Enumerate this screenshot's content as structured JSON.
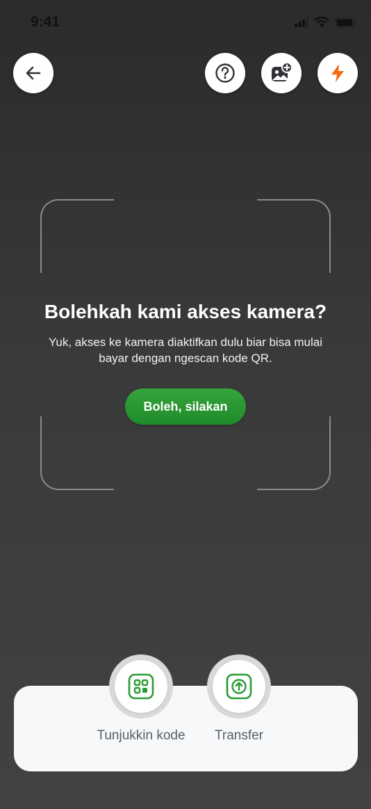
{
  "status_bar": {
    "time": "9:41"
  },
  "header": {
    "icons": [
      "back-arrow-icon",
      "help-icon",
      "gallery-add-icon",
      "flash-icon"
    ],
    "accent_color": "#f46b14"
  },
  "camera_prompt": {
    "title": "Bolehkah kami akses kamera?",
    "description": "Yuk, akses ke kamera diaktifkan dulu biar bisa mulai bayar dengan ngescan kode QR.",
    "allow_button_label": "Boleh, silakan",
    "button_color": "#2a9a33"
  },
  "bottom_actions": [
    {
      "label": "Tunjukkin kode",
      "icon": "qr-code-icon"
    },
    {
      "label": "Transfer",
      "icon": "transfer-upload-icon"
    }
  ]
}
